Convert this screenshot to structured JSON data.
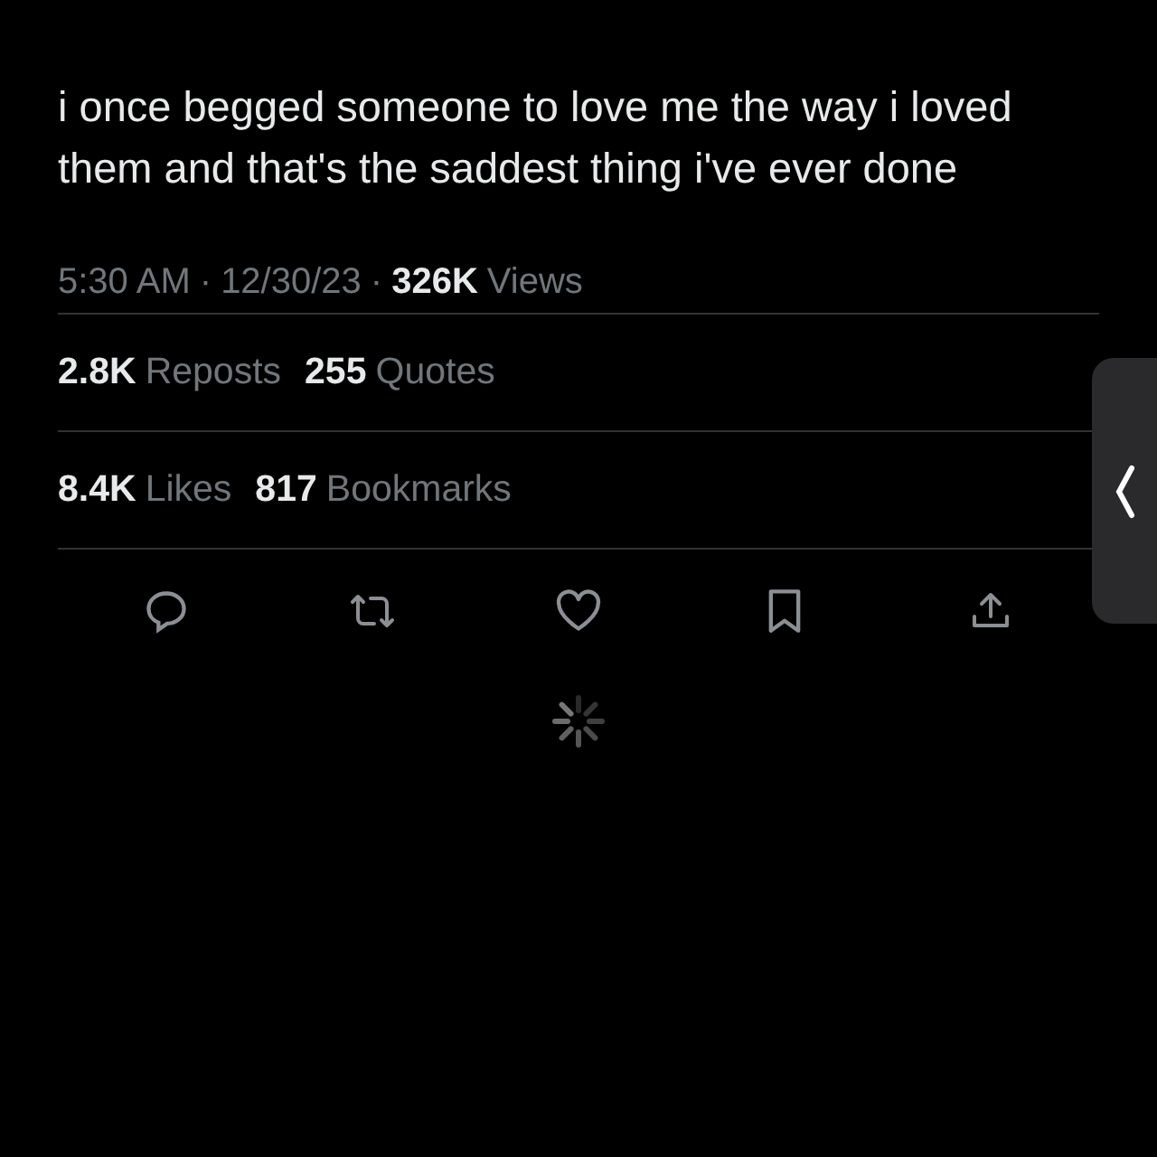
{
  "post": {
    "text": "i once begged someone to love me the way i loved them and that's the saddest thing i've ever done"
  },
  "meta": {
    "time": "5:30 AM",
    "separator_1": "·",
    "date": "12/30/23",
    "separator_2": "·",
    "views_count": "326K",
    "views_label": "Views"
  },
  "stats": [
    [
      {
        "count": "2.8K",
        "label": "Reposts"
      },
      {
        "count": "255",
        "label": "Quotes"
      }
    ],
    [
      {
        "count": "8.4K",
        "label": "Likes"
      },
      {
        "count": "817",
        "label": "Bookmarks"
      }
    ]
  ],
  "actions": [
    {
      "kind": "reply"
    },
    {
      "kind": "repost"
    },
    {
      "kind": "like"
    },
    {
      "kind": "bookmark"
    },
    {
      "kind": "share"
    }
  ]
}
